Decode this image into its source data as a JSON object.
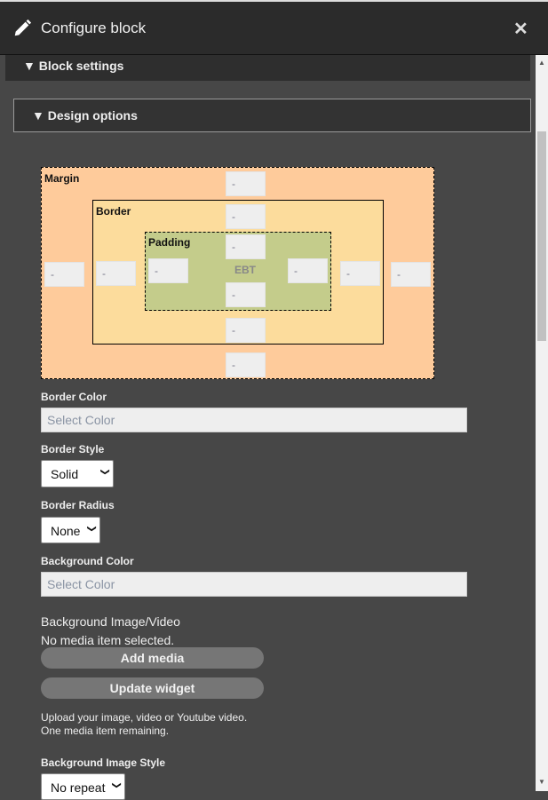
{
  "header": {
    "title": "Configure block",
    "close": "✕"
  },
  "sections": {
    "block_settings": "▼ Block settings",
    "design_options": "▼ Design options"
  },
  "box_model": {
    "margin_label": "Margin",
    "border_label": "Border",
    "padding_label": "Padding",
    "center_label": "EBT",
    "placeholder": "-"
  },
  "border_color": {
    "label": "Border Color",
    "placeholder": "Select Color"
  },
  "border_style": {
    "label": "Border Style",
    "value": "Solid"
  },
  "border_radius": {
    "label": "Border Radius",
    "value": "None"
  },
  "background_color": {
    "label": "Background Color",
    "placeholder": "Select Color"
  },
  "background_media": {
    "label": "Background Image/Video",
    "status": "No media item selected.",
    "add_button": "Add media",
    "update_button": "Update widget",
    "help_line1": "Upload your image, video or Youtube video.",
    "help_line2": "One media item remaining."
  },
  "background_image_style": {
    "label": "Background Image Style",
    "value": "No repeat"
  }
}
